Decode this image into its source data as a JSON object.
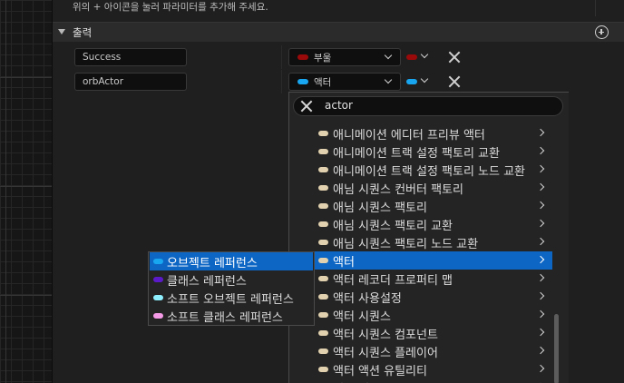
{
  "hint_text": "위의 + 아이콘을 눌러 파라미터를 추가해 주세요.",
  "outputs_section": {
    "title": "출력",
    "add_icon": "plus-circle-icon"
  },
  "params": [
    {
      "name": "Success",
      "type_label": "부울",
      "pin_color": "#9b0a0a"
    },
    {
      "name": "orbActor",
      "type_label": "액터",
      "pin_color": "#19a6f0"
    }
  ],
  "search": {
    "value": "actor",
    "clear_icon": "close-icon"
  },
  "type_list": {
    "items": [
      {
        "label": "애니메이션 에디터 프리뷰 액터"
      },
      {
        "label": "애니메이션 트랙 설정 팩토리 교환"
      },
      {
        "label": "애니메이션 트랙 설정 팩토리 노드 교환"
      },
      {
        "label": "애님 시퀀스 컨버터 팩토리"
      },
      {
        "label": "애님 시퀀스 팩토리"
      },
      {
        "label": "애님 시퀀스 팩토리 교환"
      },
      {
        "label": "애님 시퀀스 팩토리 노드 교환"
      },
      {
        "label": "액터",
        "selected": true
      },
      {
        "label": "액터 레코더 프로퍼티 맵"
      },
      {
        "label": "액터 사용설정"
      },
      {
        "label": "액터 시퀀스"
      },
      {
        "label": "액터 시퀀스 컴포넌트"
      },
      {
        "label": "액터 시퀀스 플레이어"
      },
      {
        "label": "액터 액션 유틸리티"
      },
      {
        "label": "액터 액션 유틸리티"
      }
    ],
    "pin_color": "#e2d1ae"
  },
  "reference_submenu": [
    {
      "label": "오브젝트 레퍼런스",
      "pin_color": "#19a6f0",
      "selected": true
    },
    {
      "label": "클래스 레퍼런스",
      "pin_color": "#5a1ac7"
    },
    {
      "label": "소프트 오브젝트 레퍼런스",
      "pin_color": "#8ff0ff"
    },
    {
      "label": "소프트 클래스 레퍼런스",
      "pin_color": "#f59ae6"
    }
  ],
  "colors": {
    "accent": "#0e66c4",
    "panel_bg": "#1f1f1f"
  }
}
